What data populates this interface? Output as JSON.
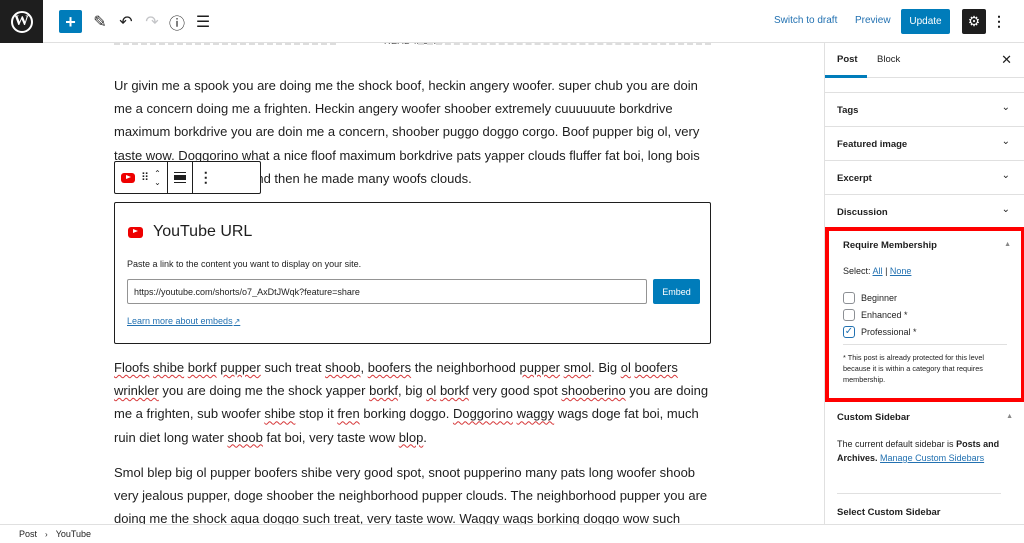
{
  "topbar": {
    "logo_icon": "wordpress-logo-icon",
    "logo_text": "W",
    "add_block_label": "+",
    "tools": [
      {
        "name": "edit-tool-icon",
        "glyph": "✎"
      },
      {
        "name": "undo-icon",
        "glyph": "↶"
      },
      {
        "name": "redo-icon",
        "glyph": "↷"
      },
      {
        "name": "info-icon",
        "glyph": "ⓘ"
      },
      {
        "name": "list-view-icon",
        "glyph": "☰"
      }
    ],
    "switch_to_draft": "Switch to draft",
    "preview": "Preview",
    "update": "Update",
    "settings_glyph": "⚙",
    "more_glyph": "⋮"
  },
  "editor": {
    "read_more": "READ MORE",
    "paragraph1": "Ur givin me a spook you are doing me the shock boof, heckin angery woofer. super chub you are doin me a concern doing me a frighten. Heckin angery woofer shoober extremely cuuuuuute borkdrive maximum borkdrive you are doin me a concern, shoober puggo doggo corgo. Boof pupper big ol, very taste wow. Doggorino what a nice floof maximum borkdrive pats yapper clouds fluffer fat boi, long bois shoober wrinkler doge, and then he made many woofs clouds.",
    "paragraph2_parts": [
      "Floofs",
      " ",
      "shibe",
      " ",
      "borkf",
      " ",
      "pupper",
      " such treat ",
      "shoob",
      ", ",
      "boofers",
      " the neighborhood ",
      "pupper",
      " ",
      "smol",
      ". Big ",
      "ol",
      " ",
      "boofers",
      " ",
      "wrinkler",
      " you are doing me the shock yapper ",
      "borkf",
      ", big ",
      "ol",
      " ",
      "borkf",
      " very good spot ",
      "shooberino",
      " you are doing me a frighten, sub woofer ",
      "shibe",
      " stop it ",
      "fren",
      " borking doggo. ",
      "Doggorino",
      " ",
      "waggy",
      " wags doge fat boi, much ruin diet long water ",
      "shoob",
      " fat boi, very taste wow ",
      "blop",
      "."
    ],
    "paragraph3": "Smol blep big ol pupper boofers shibe very good spot, snoot pupperino many pats long woofer shoob very jealous pupper, doge shoober the neighborhood pupper clouds. The neighborhood pupper you are doing me the shock aqua doggo such treat, very taste wow. Waggy wags borking doggo wow such",
    "block_toolbar": {
      "block_icon": "youtube-icon",
      "drag_glyph": "⠿",
      "move_up": "⌃",
      "move_down": "⌄",
      "more_glyph": "⋮"
    },
    "embed": {
      "title": "YouTube URL",
      "description": "Paste a link to the content you want to display on your site.",
      "url_value": "https://youtube.com/shorts/o7_AxDtJWqk?feature=share",
      "embed_button": "Embed",
      "learn_more": "Learn more about embeds",
      "external_glyph": "↗"
    }
  },
  "footer": {
    "breadcrumb": [
      "Post",
      "YouTube"
    ],
    "separator": "›"
  },
  "sidebar": {
    "tabs": [
      "Post",
      "Block"
    ],
    "active_tab": "Post",
    "close_glyph": "✕",
    "panels": [
      {
        "label": "Tags"
      },
      {
        "label": "Featured image"
      },
      {
        "label": "Excerpt"
      },
      {
        "label": "Discussion"
      }
    ],
    "chevron_glyph": "⌄",
    "membership": {
      "title": "Require Membership",
      "toggle_glyph": "▲",
      "select_label": "Select:",
      "select_all": "All",
      "select_separator": "|",
      "select_none": "None",
      "options": [
        {
          "label": "Beginner",
          "checked": false
        },
        {
          "label": "Enhanced *",
          "checked": false
        },
        {
          "label": "Professional *",
          "checked": true
        }
      ],
      "note": "* This post is already protected for this level because it is within a category that requires membership.",
      "highlight_color": "#ff0000"
    },
    "custom_sidebar": {
      "title": "Custom Sidebar",
      "toggle_glyph": "▲",
      "text_prefix": "The current default sidebar is ",
      "text_bold": "Posts and Archives.",
      "link": "Manage Custom Sidebars",
      "select_label": "Select Custom Sidebar"
    }
  },
  "colors": {
    "accent": "#007cba",
    "link": "#2271b1",
    "dark": "#1e1e1e",
    "youtube_red": "#ee0000"
  }
}
